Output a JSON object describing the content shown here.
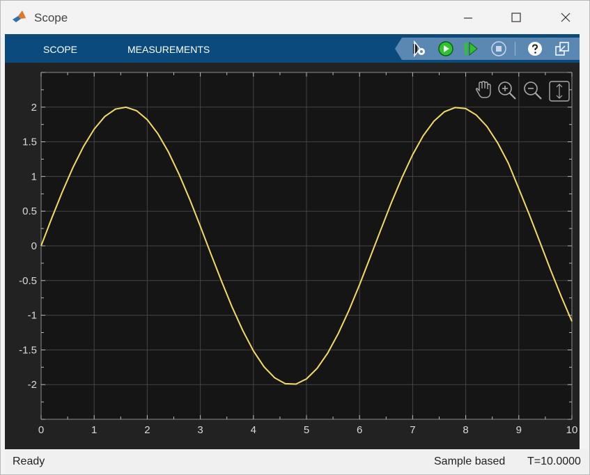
{
  "window": {
    "title": "Scope",
    "controls": [
      "minimize-icon",
      "maximize-icon",
      "close-icon"
    ]
  },
  "toolstrip": {
    "tabs": [
      {
        "label": "SCOPE"
      },
      {
        "label": "MEASUREMENTS"
      }
    ],
    "buttons": [
      {
        "icon": "settings-icon"
      },
      {
        "icon": "run-icon"
      },
      {
        "icon": "step-forward-icon"
      },
      {
        "icon": "stop-icon"
      },
      {
        "icon": "help-icon"
      },
      {
        "icon": "undock-icon"
      }
    ],
    "accent_color": "#0b4a7d",
    "run_color": "#2ec42e"
  },
  "axes_tools": [
    "pan-icon",
    "zoom-in-icon",
    "zoom-out-icon",
    "autoscale-icon"
  ],
  "chart_data": {
    "type": "line",
    "title": "",
    "xlabel": "",
    "ylabel": "",
    "xlim": [
      0,
      10
    ],
    "ylim": [
      -2.5,
      2.5
    ],
    "x_ticks": [
      0,
      1,
      2,
      3,
      4,
      5,
      6,
      7,
      8,
      9,
      10
    ],
    "y_ticks": [
      2,
      1.5,
      1,
      0.5,
      0,
      -0.5,
      -1,
      -1.5,
      -2
    ],
    "x_tick_labels": [
      "0",
      "1",
      "2",
      "3",
      "4",
      "5",
      "6",
      "7",
      "8",
      "9",
      "10"
    ],
    "y_tick_labels": [
      "2",
      "1.5",
      "1",
      "0.5",
      "0",
      "-0.5",
      "-1",
      "-1.5",
      "-2"
    ],
    "grid": true,
    "background": "#151515",
    "line_color": "#f5dc5f",
    "series": [
      {
        "x": [
          0,
          0.2,
          0.4,
          0.6,
          0.8,
          1.0,
          1.2,
          1.4,
          1.6,
          1.8,
          2.0,
          2.2,
          2.4,
          2.6,
          2.8,
          3.0,
          3.2,
          3.4,
          3.6,
          3.8,
          4.0,
          4.2,
          4.4,
          4.6,
          4.8,
          5.0,
          5.2,
          5.4,
          5.6,
          5.8,
          6.0,
          6.2,
          6.4,
          6.6,
          6.8,
          7.0,
          7.2,
          7.4,
          7.6,
          7.8,
          8.0,
          8.2,
          8.4,
          8.6,
          8.8,
          9.0,
          9.2,
          9.4,
          9.6,
          9.8,
          10.0
        ],
        "y": [
          0,
          0.397,
          0.779,
          1.129,
          1.435,
          1.683,
          1.864,
          1.971,
          1.999,
          1.948,
          1.819,
          1.617,
          1.351,
          1.031,
          0.67,
          0.282,
          -0.117,
          -0.511,
          -0.885,
          -1.222,
          -1.514,
          -1.743,
          -1.903,
          -1.987,
          -1.993,
          -1.918,
          -1.767,
          -1.545,
          -1.262,
          -0.929,
          -0.559,
          -0.166,
          0.233,
          0.623,
          0.988,
          1.314,
          1.588,
          1.797,
          1.934,
          1.994,
          1.979,
          1.886,
          1.721,
          1.487,
          1.196,
          0.824,
          0.447,
          0.049,
          -0.349,
          -0.732,
          -1.088
        ]
      }
    ]
  },
  "status": {
    "left": "Ready",
    "mode": "Sample based",
    "time": "T=10.0000"
  }
}
